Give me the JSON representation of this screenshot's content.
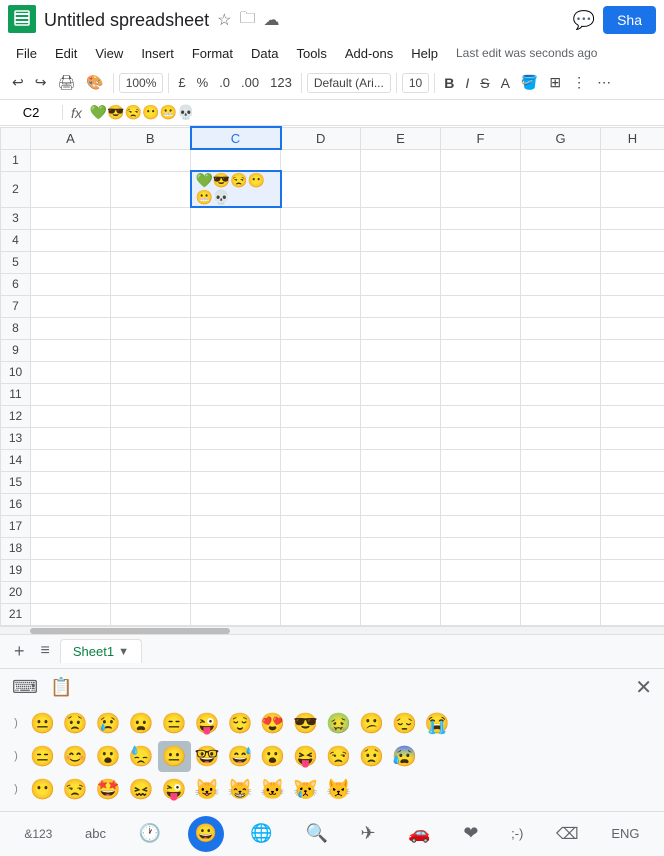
{
  "header": {
    "title": "Untitled spreadsheet",
    "share_label": "Sha",
    "last_edit": "Last edit was seconds ago"
  },
  "menubar": {
    "items": [
      "File",
      "Edit",
      "View",
      "Insert",
      "Format",
      "Data",
      "Tools",
      "Add-ons",
      "Help"
    ]
  },
  "toolbar": {
    "zoom": "100%",
    "currency": "£",
    "percent": "%",
    "comma1": ".0",
    "comma2": ".00",
    "format123": "123",
    "font": "Default (Ari...",
    "font_size": "10",
    "bold": "B",
    "italic": "I",
    "strikethrough": "S"
  },
  "formula_bar": {
    "cell_ref": "C2",
    "fx": "fx",
    "content": "💚😎😒😶😬💀"
  },
  "grid": {
    "col_headers": [
      "",
      "A",
      "B",
      "C",
      "D",
      "E",
      "F",
      "G",
      "H"
    ],
    "rows": [
      1,
      2,
      3,
      4,
      5,
      6,
      7,
      8,
      9,
      10,
      11,
      12,
      13,
      14,
      15,
      16,
      17,
      18,
      19,
      20,
      21
    ],
    "selected_cell": "C2",
    "cell_content": "💚😎😒😶😬💀"
  },
  "sheet_tabs": {
    "add_label": "+",
    "menu_label": "≡",
    "active_tab": "Sheet1"
  },
  "emoji_keyboard": {
    "close_label": "×",
    "header_icons": [
      "⌨",
      "📋"
    ],
    "rows": [
      [
        ")",
        "😐",
        "😟",
        "😢",
        "😦",
        "😑",
        "😜",
        "😌",
        "😍",
        "😎",
        "🤢",
        "😕",
        "😔",
        "😭"
      ],
      [
        ")",
        "😑",
        "😊",
        "😮",
        "😓",
        "🤓",
        "😐",
        "😅",
        "😮",
        "😝",
        "😒",
        "😟",
        "😰"
      ],
      [
        ")",
        "😶",
        "😒",
        "🤩",
        "😖",
        "😜",
        "😺",
        "😸",
        "🐱",
        "😿",
        "😾"
      ]
    ],
    "bottom_bar": [
      {
        "label": "&123",
        "name": "numbers-btn"
      },
      {
        "label": "abc",
        "name": "abc-btn"
      },
      {
        "label": "🕐",
        "name": "recent-btn"
      },
      {
        "label": "😀",
        "name": "emoji-btn",
        "active": true
      },
      {
        "label": "🌐",
        "name": "globe-btn"
      },
      {
        "label": "🔍",
        "name": "search-btn"
      },
      {
        "label": "✈",
        "name": "travel-btn"
      },
      {
        "label": "🚗",
        "name": "transport-btn"
      },
      {
        "label": "❤",
        "name": "heart-btn"
      },
      {
        "label": ";-)",
        "name": "kaomoji-btn"
      },
      {
        "label": "⌫",
        "name": "delete-btn"
      },
      {
        "label": "ENG",
        "name": "lang-btn"
      }
    ]
  }
}
